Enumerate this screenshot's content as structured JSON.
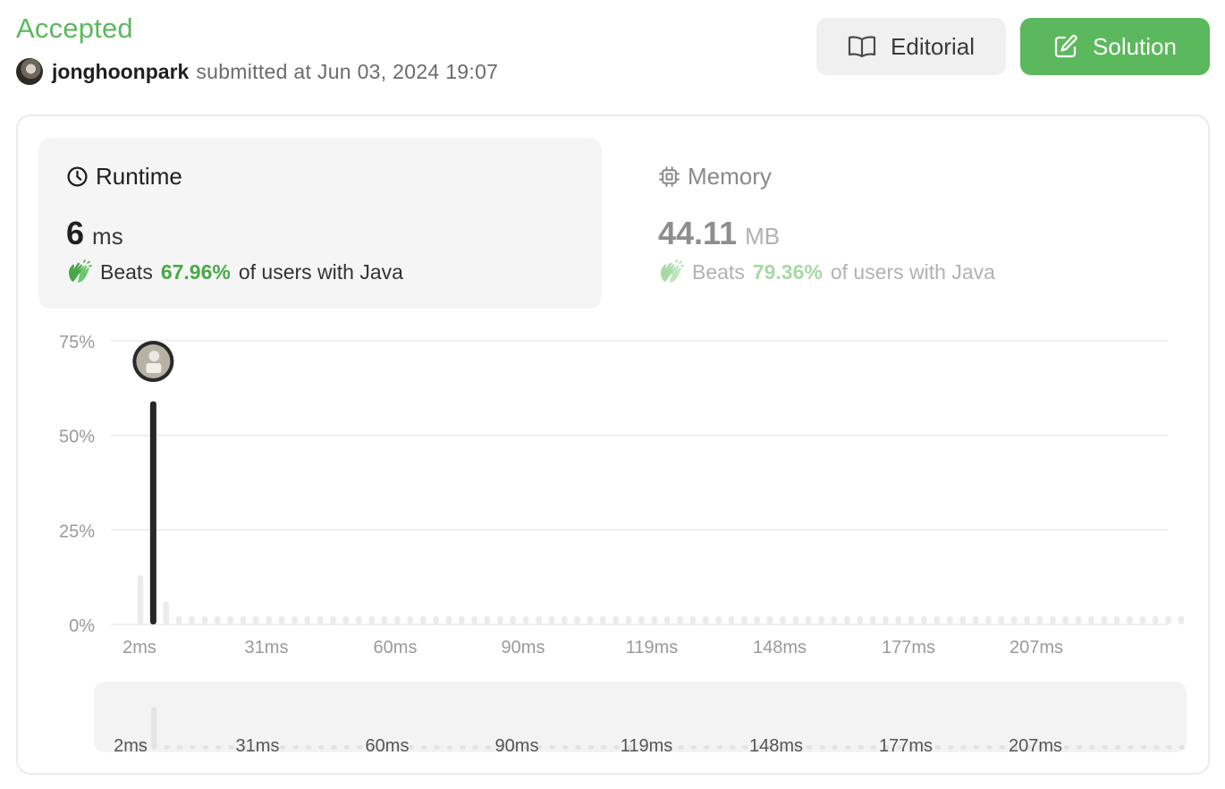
{
  "header": {
    "status": "Accepted",
    "username": "jonghoonpark",
    "submitted_text": "submitted at Jun 03, 2024 19:07",
    "editorial_label": "Editorial",
    "solution_label": "Solution"
  },
  "runtime": {
    "title": "Runtime",
    "value": "6",
    "unit": "ms",
    "beats_prefix": "Beats",
    "beats_pct": "67.96%",
    "beats_suffix": "of users with Java"
  },
  "memory": {
    "title": "Memory",
    "value": "44.11",
    "unit": "MB",
    "beats_prefix": "Beats",
    "beats_pct": "79.36%",
    "beats_suffix": "of users with Java"
  },
  "colors": {
    "accepted": "#5cb85c",
    "solution_button": "#5cb85c",
    "beats_active": "#4aa84a",
    "beats_muted": "#a6d9a6",
    "highlight_bar": "#262626",
    "bar": "#ebebeb"
  },
  "icons": {
    "editorial": "book-open-icon",
    "solution": "edit-icon",
    "runtime": "clock-icon",
    "memory": "chip-icon",
    "beats": "clapping-hands-icon"
  },
  "chart_data": [
    {
      "type": "bar",
      "y_unit": "%",
      "ylim": [
        0,
        75
      ],
      "y_ticks": [
        "0%",
        "25%",
        "50%",
        "75%"
      ],
      "x_tick_labels": [
        "2ms",
        "31ms",
        "60ms",
        "90ms",
        "119ms",
        "148ms",
        "177ms",
        "207ms"
      ],
      "grid": true,
      "highlight_index": 1,
      "values": [
        13,
        59,
        6,
        2.2,
        2.2,
        2.2,
        2.2,
        2.2,
        2.2,
        2.2,
        2.2,
        2.2,
        2.2,
        2.2,
        2.2,
        2.2,
        2.2,
        2.2,
        2.2,
        2.2,
        2.2,
        2.2,
        2.2,
        2.2,
        2.2,
        2.2,
        2.2,
        2.2,
        2.2,
        2.2,
        2.2,
        2.2,
        2.2,
        2.2,
        2.2,
        2.2,
        2.2,
        2.2,
        2.2,
        2.2,
        2.2,
        2.2,
        2.2,
        2.2,
        2.2,
        2.2,
        2.2,
        2.2,
        2.2,
        2.2,
        2.2,
        2.2,
        2.2,
        2.2,
        2.2,
        2.2,
        2.2,
        2.2,
        2.2,
        2.2,
        2.2,
        2.2,
        2.2,
        2.2,
        2.2,
        2.2,
        2.2,
        2.2,
        2.2,
        2.2,
        2.2,
        2.2,
        2.2,
        2.2,
        2.2,
        2.2,
        2.2,
        2.2,
        2.2,
        2.2,
        2.2,
        2.2
      ]
    },
    {
      "type": "bar",
      "role": "range-navigator",
      "x_tick_labels": [
        "2ms",
        "31ms",
        "60ms",
        "90ms",
        "119ms",
        "148ms",
        "177ms",
        "207ms"
      ],
      "values": [
        13,
        59,
        6,
        2.2,
        2.2,
        2.2,
        2.2,
        2.2,
        2.2,
        2.2,
        2.2,
        2.2,
        2.2,
        2.2,
        2.2,
        2.2,
        2.2,
        2.2,
        2.2,
        2.2,
        2.2,
        2.2,
        2.2,
        2.2,
        2.2,
        2.2,
        2.2,
        2.2,
        2.2,
        2.2,
        2.2,
        2.2,
        2.2,
        2.2,
        2.2,
        2.2,
        2.2,
        2.2,
        2.2,
        2.2,
        2.2,
        2.2,
        2.2,
        2.2,
        2.2,
        2.2,
        2.2,
        2.2,
        2.2,
        2.2,
        2.2,
        2.2,
        2.2,
        2.2,
        2.2,
        2.2,
        2.2,
        2.2,
        2.2,
        2.2,
        2.2,
        2.2,
        2.2,
        2.2,
        2.2,
        2.2,
        2.2,
        2.2,
        2.2,
        2.2,
        2.2,
        2.2,
        2.2,
        2.2,
        2.2,
        2.2,
        2.2,
        2.2,
        2.2,
        2.2,
        2.2,
        2.2
      ]
    }
  ]
}
